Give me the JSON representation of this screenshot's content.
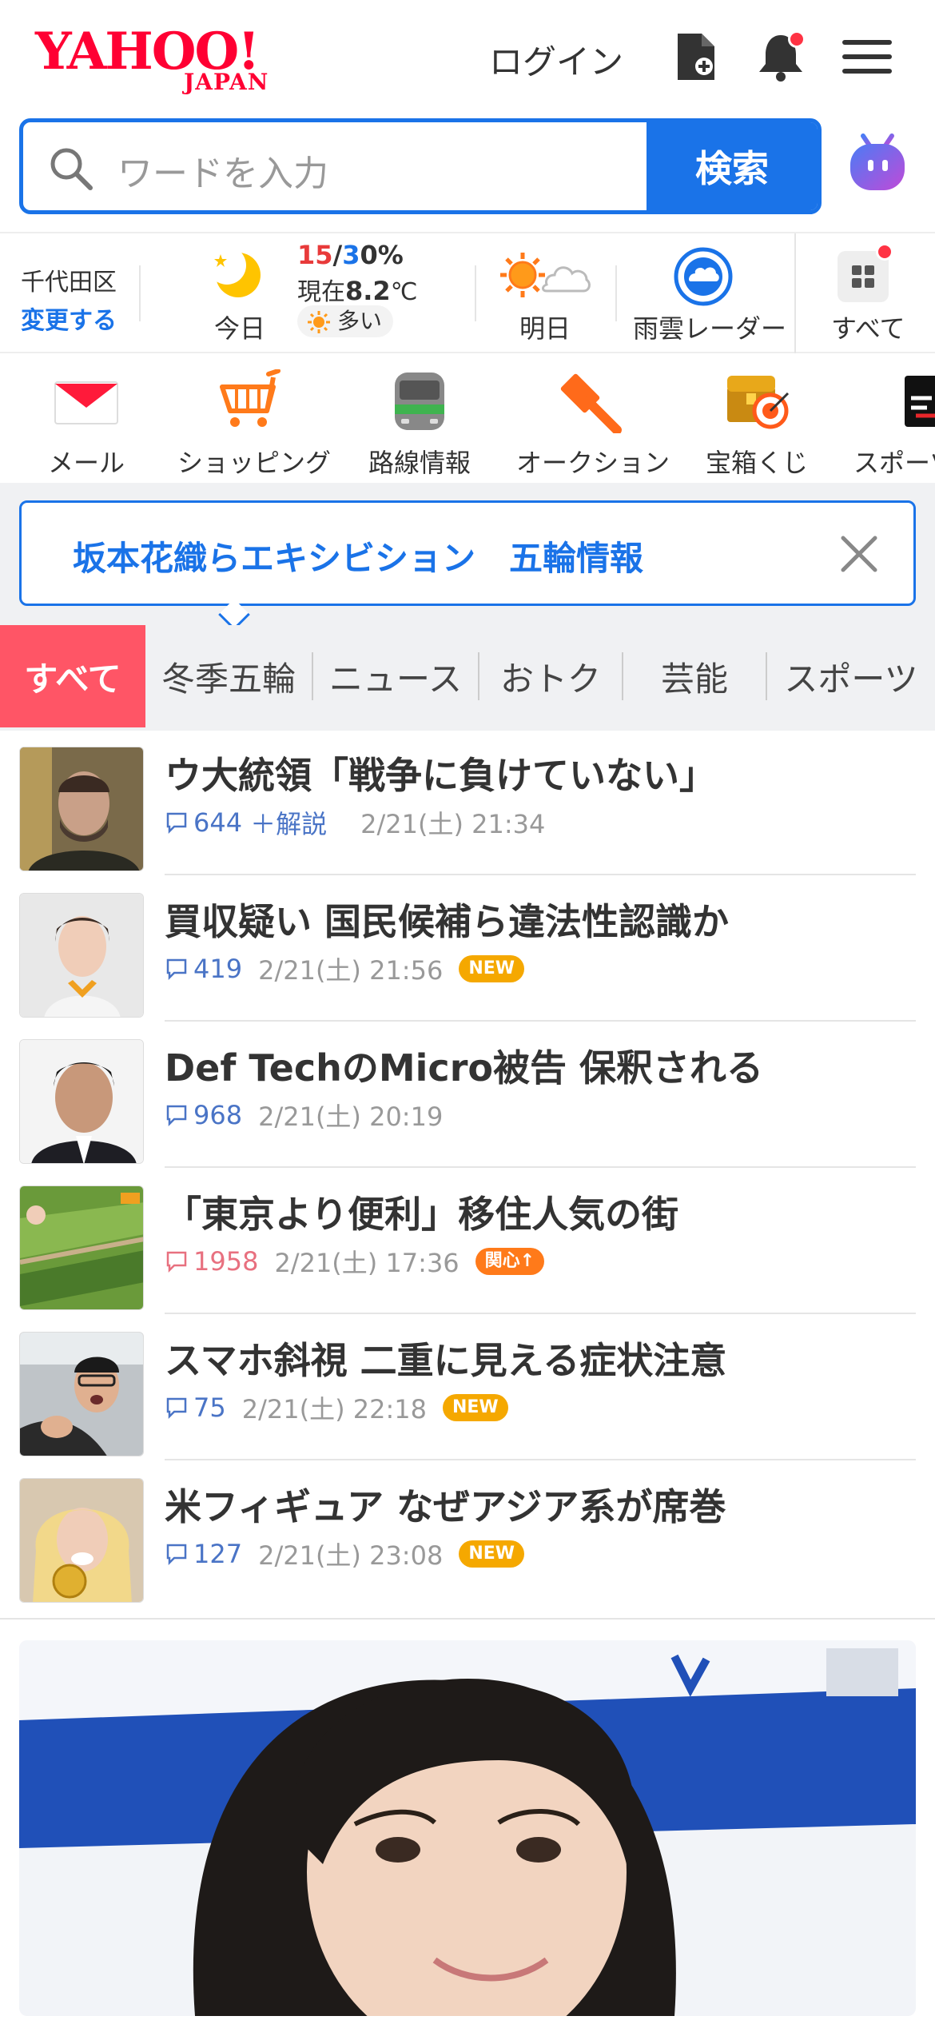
{
  "header": {
    "logo_main": "YAHOO!",
    "logo_sub": "JAPAN",
    "login_label": "ログイン"
  },
  "search": {
    "placeholder": "ワードを入力",
    "button_label": "検索"
  },
  "weather": {
    "area": "千代田区",
    "change_label": "変更する",
    "today_label": "今日",
    "high": "15",
    "slash": "/",
    "low": "3",
    "precip": "0%",
    "now_prefix": "現在",
    "now_temp": "8.2",
    "now_unit": "℃",
    "pollen": "多い",
    "tomorrow_label": "明日",
    "radar_label": "雨雲レーダー",
    "all_label": "すべて"
  },
  "services": [
    {
      "label": "メール",
      "icon": "mail-icon"
    },
    {
      "label": "ショッピング",
      "icon": "cart-icon"
    },
    {
      "label": "路線情報",
      "icon": "train-icon"
    },
    {
      "label": "オークション",
      "icon": "auction-hammer-icon"
    },
    {
      "label": "宝箱くじ",
      "icon": "treasure-box-icon"
    },
    {
      "label": "スポーツ",
      "icon": "sports-logo-icon"
    }
  ],
  "topic_banner": {
    "text": "坂本花織らエキシビション　五輪情報"
  },
  "tabs": [
    "すべて",
    "冬季五輪",
    "ニュース",
    "おトク",
    "芸能",
    "スポーツ"
  ],
  "news": [
    {
      "title": "ウ大統領「戦争に負けていない」",
      "comments": "644",
      "extra": "＋解説",
      "time": "2/21(土) 21:34",
      "badge": ""
    },
    {
      "title": "買収疑い 国民候補ら違法性認識か",
      "comments": "419",
      "extra": "",
      "time": "2/21(土) 21:56",
      "badge": "NEW"
    },
    {
      "title": "Def TechのMicro被告 保釈される",
      "comments": "968",
      "extra": "",
      "time": "2/21(土) 20:19",
      "badge": ""
    },
    {
      "title": "「東京より便利」移住人気の街",
      "comments": "1958",
      "extra": "",
      "time": "2/21(土) 17:36",
      "badge": "関心↑"
    },
    {
      "title": "スマホ斜視 二重に見える症状注意",
      "comments": "75",
      "extra": "",
      "time": "2/21(土) 22:18",
      "badge": "NEW"
    },
    {
      "title": "米フィギュア なぜアジア系が席巻",
      "comments": "127",
      "extra": "",
      "time": "2/21(土) 23:08",
      "badge": "NEW"
    }
  ],
  "colors": {
    "brand_red": "#ff0033",
    "accent_blue": "#1a73e8",
    "tab_active": "#ff5566",
    "new_badge": "#f5a800",
    "interest_badge": "#ff7a1a"
  }
}
